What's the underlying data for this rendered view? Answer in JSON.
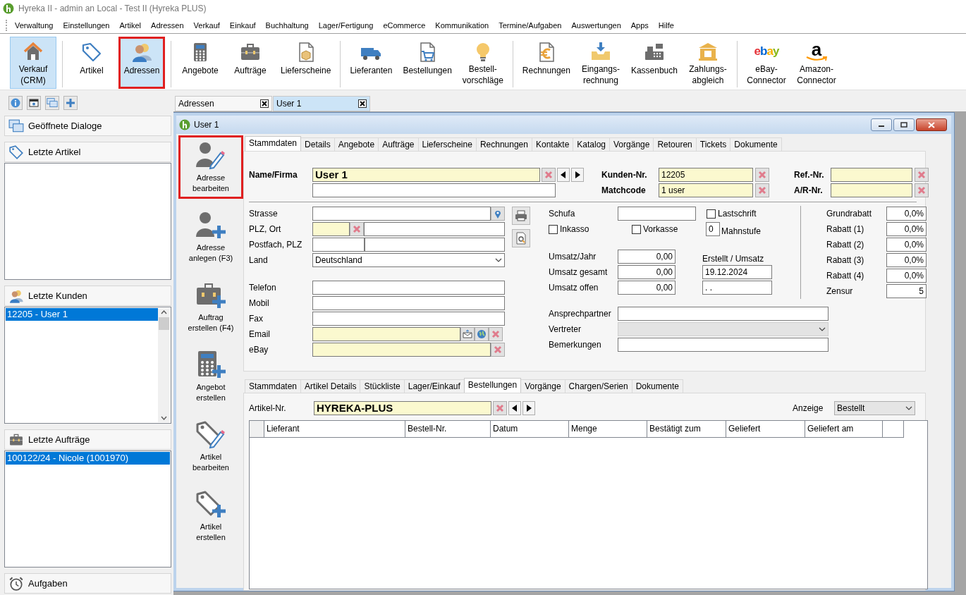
{
  "window": {
    "title": "Hyreka II - admin an Local - Test II (Hyreka PLUS)"
  },
  "menu": [
    "Verwaltung",
    "Einstellungen",
    "Artikel",
    "Adressen",
    "Verkauf",
    "Einkauf",
    "Buchhaltung",
    "Lager/Fertigung",
    "eCommerce",
    "Kommunikation",
    "Termine/Aufgaben",
    "Auswertungen",
    "Apps",
    "Hilfe"
  ],
  "toolbar": {
    "groups": [
      [
        {
          "label": "Verkauf\n(CRM)",
          "selected": true,
          "highlighted": false
        }
      ],
      [
        {
          "label": "Artikel",
          "selected": false,
          "highlighted": false
        },
        {
          "label": "Adressen",
          "selected": true,
          "highlighted": true
        }
      ],
      [
        {
          "label": "Angebote",
          "selected": false,
          "highlighted": false
        },
        {
          "label": "Aufträge",
          "selected": false,
          "highlighted": false
        },
        {
          "label": "Lieferscheine",
          "selected": false,
          "highlighted": false
        }
      ],
      [
        {
          "label": "Lieferanten",
          "selected": false,
          "highlighted": false
        },
        {
          "label": "Bestellungen",
          "selected": false,
          "highlighted": false
        },
        {
          "label": "Bestell-\nvorschläge",
          "selected": false,
          "highlighted": false
        }
      ],
      [
        {
          "label": "Rechnungen",
          "selected": false,
          "highlighted": false
        },
        {
          "label": "Eingangs-\nrechnung",
          "selected": false,
          "highlighted": false
        },
        {
          "label": "Kassenbuch",
          "selected": false,
          "highlighted": false
        },
        {
          "label": "Zahlungs-\nabgleich",
          "selected": false,
          "highlighted": false
        }
      ],
      [
        {
          "label": "eBay-\nConnector",
          "logo": "ebay",
          "selected": false,
          "highlighted": false
        },
        {
          "label": "Amazon-\nConnector",
          "logo": "a",
          "selected": false,
          "highlighted": false
        }
      ]
    ]
  },
  "sidebar": {
    "sections": [
      {
        "title": "Geöffnete Dialoge",
        "kind": "header"
      },
      {
        "title": "Letzte Artikel",
        "kind": "list"
      },
      {
        "title": "Letzte Kunden",
        "kind": "scroll-list",
        "items": [
          {
            "text": "12205 - User 1",
            "selected": true
          }
        ]
      },
      {
        "title": "Letzte Aufträge",
        "kind": "list",
        "items": [
          {
            "text": "100122/24 - Nicole (1001970)",
            "selected": true
          }
        ]
      },
      {
        "title": "Aufgaben",
        "kind": "header"
      }
    ]
  },
  "document_tabs": [
    {
      "label": "Adressen",
      "selected": false
    },
    {
      "label": "User 1",
      "selected": true
    }
  ],
  "dialog": {
    "title": "User 1",
    "actions": [
      {
        "label": "Adresse\nbearbeiten",
        "highlighted": true
      },
      {
        "label": "Adresse\nanlegen (F3)",
        "highlighted": false
      },
      {
        "label": "Auftrag\nerstellen (F4)",
        "highlighted": false
      },
      {
        "label": "Angebot\nerstellen",
        "highlighted": false
      },
      {
        "label": "Artikel\nbearbeiten",
        "highlighted": false
      },
      {
        "label": "Artikel\nerstellen",
        "highlighted": false
      }
    ],
    "tabs": [
      {
        "label": "Stammdaten",
        "selected": true
      },
      {
        "label": "Details",
        "selected": false
      },
      {
        "label": "Angebote",
        "selected": false
      },
      {
        "label": "Aufträge",
        "selected": false
      },
      {
        "label": "Lieferscheine",
        "selected": false
      },
      {
        "label": "Rechnungen",
        "selected": false
      },
      {
        "label": "Kontakte",
        "selected": false
      },
      {
        "label": "Katalog",
        "selected": false
      },
      {
        "label": "Vorgänge",
        "selected": false
      },
      {
        "label": "Retouren",
        "selected": false
      },
      {
        "label": "Tickets",
        "selected": false
      },
      {
        "label": "Dokumente",
        "selected": false
      }
    ],
    "form": {
      "name": {
        "label": "Name/Firma",
        "value": "User 1"
      },
      "customer_no": {
        "label": "Kunden-Nr.",
        "value": "12205"
      },
      "matchcode": {
        "label": "Matchcode",
        "value": "1 user"
      },
      "ref_no": {
        "label": "Ref.-Nr."
      },
      "ar_no": {
        "label": "A/R-Nr."
      },
      "address": [
        {
          "label": "Strasse",
          "kind": "pin"
        },
        {
          "label": "PLZ, Ort",
          "kind": "split-clear"
        },
        {
          "label": "Postfach, PLZ",
          "kind": "split"
        },
        {
          "label": "Land",
          "kind": "select",
          "value": "Deutschland"
        }
      ],
      "contact": [
        {
          "label": "Telefon",
          "kind": "text"
        },
        {
          "label": "Mobil",
          "kind": "text"
        },
        {
          "label": "Fax",
          "kind": "text"
        },
        {
          "label": "Email",
          "kind": "email"
        },
        {
          "label": "eBay",
          "kind": "clear"
        }
      ],
      "schufa": {
        "label": "Schufa"
      },
      "checkboxes": [
        {
          "label": "Lastschrift",
          "checked": false
        },
        {
          "label": "Inkasso",
          "checked": false
        },
        {
          "label": "Vorkasse",
          "checked": false
        }
      ],
      "dunning": {
        "label": "Mahnstufe",
        "value": "0"
      },
      "revenue": [
        {
          "label": "Umsatz/Jahr",
          "value": "0,00"
        },
        {
          "label": "Umsatz gesamt",
          "value": "0,00"
        },
        {
          "label": "Umsatz offen",
          "value": "0,00"
        }
      ],
      "created": {
        "label": "Erstellt / Umsatz",
        "date": "19.12.2024",
        "date_2": ".  ."
      },
      "discounts": [
        {
          "label": "Grundrabatt",
          "value": "0,0%"
        },
        {
          "label": "Rabatt (1)",
          "value": "0,0%"
        },
        {
          "label": "Rabatt (2)",
          "value": "0,0%"
        },
        {
          "label": "Rabatt (3)",
          "value": "0,0%"
        },
        {
          "label": "Rabatt (4)",
          "value": "0,0%"
        },
        {
          "label": "Zensur",
          "value": "5"
        }
      ],
      "extra": [
        {
          "label": "Ansprechpartner",
          "kind": "text",
          "disabled": false
        },
        {
          "label": "Vertreter",
          "kind": "select",
          "disabled": true
        },
        {
          "label": "Bemerkungen",
          "kind": "text",
          "disabled": false
        }
      ]
    },
    "lower_tabs": [
      {
        "label": "Stammdaten",
        "selected": false
      },
      {
        "label": "Artikel Details",
        "selected": false
      },
      {
        "label": "Stückliste",
        "selected": false
      },
      {
        "label": "Lager/Einkauf",
        "selected": false
      },
      {
        "label": "Bestellungen",
        "selected": true
      },
      {
        "label": "Vorgänge",
        "selected": false
      },
      {
        "label": "Chargen/Serien",
        "selected": false
      },
      {
        "label": "Dokumente",
        "selected": false
      }
    ],
    "article": {
      "label": "Artikel-Nr.",
      "value": "HYREKA-PLUS"
    },
    "display": {
      "label": "Anzeige",
      "value": "Bestellt"
    },
    "table": {
      "columns": [
        "Lieferant",
        "Bestell-Nr.",
        "Datum",
        "Menge",
        "Bestätigt zum",
        "Geliefert",
        "Geliefert am"
      ]
    }
  }
}
